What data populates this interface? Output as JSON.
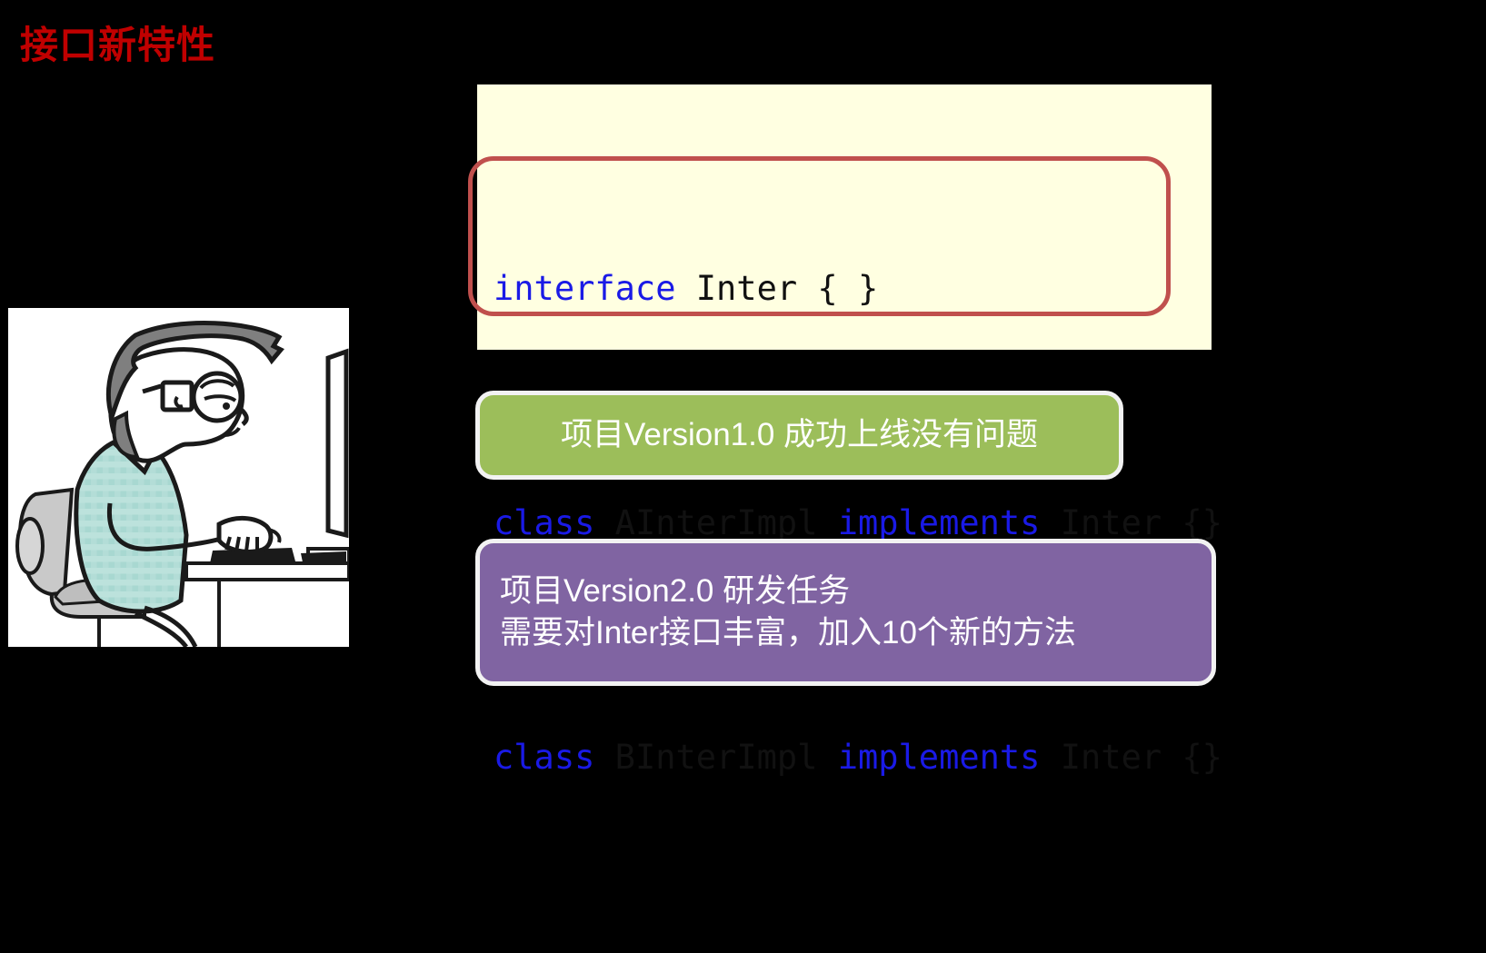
{
  "slide": {
    "title": "接口新特性",
    "background_color": "#000000",
    "title_color": "#C00000"
  },
  "illustration": {
    "name": "programmer-at-desk-illustration",
    "alt": "卡通程序员坐在椅子上使用电脑打字",
    "background_color": "#FFFFFF",
    "hair_color": "#7F7F7F",
    "shirt_color": "#A6D9D2",
    "chair_color": "#BFBFBF"
  },
  "code_panel": {
    "background_color": "#FFFFE1",
    "keyword_color": "#1A1AE6",
    "identifier_color": "#111111",
    "highlight_border_color": "#C0504D",
    "lines": [
      {
        "id": "code-line-interface",
        "tokens": [
          {
            "text": "interface",
            "kind": "keyword"
          },
          {
            "text": " Inter { }",
            "kind": "identifier"
          }
        ],
        "plain": "interface Inter { }"
      },
      {
        "id": "code-line-ainterimpl",
        "tokens": [
          {
            "text": "class",
            "kind": "keyword"
          },
          {
            "text": " AInterImpl ",
            "kind": "identifier"
          },
          {
            "text": "implements",
            "kind": "keyword"
          },
          {
            "text": " Inter {}",
            "kind": "identifier"
          }
        ],
        "plain": "class AInterImpl implements Inter {}"
      },
      {
        "id": "code-line-binterimpl",
        "tokens": [
          {
            "text": "class",
            "kind": "keyword"
          },
          {
            "text": " BInterImpl ",
            "kind": "identifier"
          },
          {
            "text": "implements",
            "kind": "keyword"
          },
          {
            "text": " Inter {}",
            "kind": "identifier"
          }
        ],
        "plain": "class BInterImpl implements Inter {}"
      }
    ],
    "line_1": {
      "kw": "interface",
      "rest": " Inter { }"
    },
    "line_2": {
      "kw1": "class",
      "mid1": " AInterImpl ",
      "kw2": "implements",
      "tail": " Inter {}"
    },
    "line_3": {
      "kw1": "class",
      "mid1": " BInterImpl ",
      "kw2": "implements",
      "tail": " Inter {}"
    }
  },
  "callouts": {
    "green": {
      "text": "项目Version1.0 成功上线没有问题",
      "fill_color": "#9CBE5A",
      "border_color": "#F2F2F2",
      "text_color": "#FFFFFF"
    },
    "purple": {
      "line_1": "项目Version2.0 研发任务",
      "line_2": "需要对Inter接口丰富，加入10个新的方法",
      "fill_color": "#8064A2",
      "border_color": "#F2F2F2",
      "text_color": "#FFFFFF"
    }
  }
}
